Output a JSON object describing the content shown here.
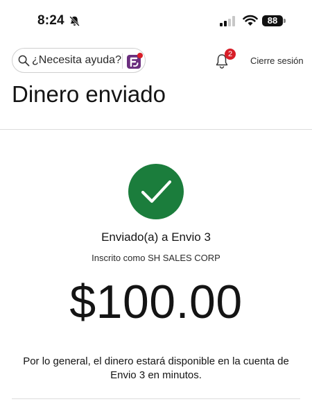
{
  "status_bar": {
    "time": "8:24",
    "battery": "88",
    "icons": [
      "bell-slash-icon",
      "signal-icon",
      "wifi-icon",
      "battery-icon"
    ]
  },
  "header": {
    "search_text": "¿Necesita ayuda?",
    "notification_count": "2",
    "logout_label": "Cierre sesión",
    "icons": [
      "search-icon",
      "assistant-icon",
      "notification-bell-icon"
    ]
  },
  "page": {
    "title": "Dinero enviado"
  },
  "confirmation": {
    "status_icon": "checkmark-icon",
    "sent_to": "Enviado(a) a Envio 3",
    "enrolled_as": "Inscrito como SH SALES CORP",
    "amount": "$100.00",
    "note": "Por lo general, el dinero estará disponible en la cuenta de Envio 3 en minutos."
  },
  "colors": {
    "success_green": "#1b7d3c",
    "badge_red": "#d71e28",
    "assistant_purple": "#6b2f7f"
  }
}
